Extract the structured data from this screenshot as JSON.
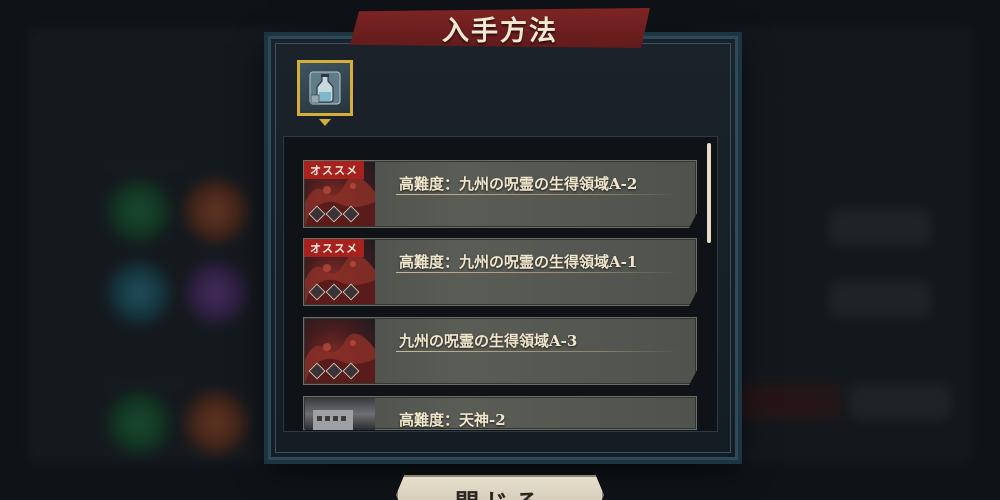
{
  "dialog": {
    "title": "入手方法"
  },
  "item": {
    "icon": "bottle-icon"
  },
  "sources": [
    {
      "tag": "オススメ",
      "title": "高難度：九州の呪霊の生得領域A-2",
      "thumb": "red-domain"
    },
    {
      "tag": "オススメ",
      "title": "高難度：九州の呪霊の生得領域A-1",
      "thumb": "red-domain"
    },
    {
      "tag": "",
      "title": "九州の呪霊の生得領域A-3",
      "thumb": "red-domain"
    },
    {
      "tag": "",
      "title": "高難度：天神-2",
      "thumb": "building"
    }
  ],
  "close_button": {
    "label": "閉じる"
  },
  "colors": {
    "banner": "#7e2424",
    "tag": "#a7221e",
    "slot_border": "#d4ad3a",
    "frame": "#2b4a5a"
  }
}
